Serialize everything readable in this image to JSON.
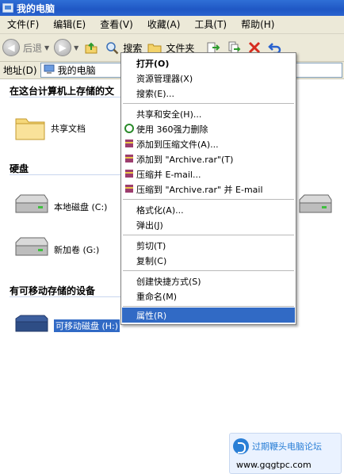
{
  "window": {
    "title": "我的电脑"
  },
  "menubar": [
    "文件(F)",
    "编辑(E)",
    "查看(V)",
    "收藏(A)",
    "工具(T)",
    "帮助(H)"
  ],
  "toolbar": {
    "back": "后退",
    "search": "搜索",
    "folders": "文件夹"
  },
  "address": {
    "label": "地址(D)",
    "value": "我的电脑"
  },
  "sections": {
    "stored": "在这台计算机上存储的文",
    "harddisks": "硬盘",
    "removable": "有可移动存储的设备"
  },
  "items": {
    "shared": "共享文档",
    "local_c": "本地磁盘 (C:)",
    "new_g": "新加卷 (G:)",
    "removable_h": "可移动磁盘 (H:)"
  },
  "context_menu": [
    {
      "label": "打开(O)",
      "bold": true
    },
    {
      "label": "资源管理器(X)"
    },
    {
      "label": "搜索(E)..."
    },
    {
      "label": "共享和安全(H)..."
    },
    {
      "label": "使用 360强力删除",
      "icon": "360-icon"
    },
    {
      "label": "添加到压缩文件(A)...",
      "icon": "winrar-icon"
    },
    {
      "label": "添加到 \"Archive.rar\"(T)",
      "icon": "winrar-icon"
    },
    {
      "label": "压缩并 E-mail...",
      "icon": "winrar-icon"
    },
    {
      "label": "压缩到 \"Archive.rar\" 并 E-mail",
      "icon": "winrar-icon"
    },
    {
      "label": "格式化(A)..."
    },
    {
      "label": "弹出(J)"
    },
    {
      "label": "剪切(T)"
    },
    {
      "label": "复制(C)"
    },
    {
      "label": "创建快捷方式(S)"
    },
    {
      "label": "重命名(M)"
    },
    {
      "label": "属性(R)",
      "highlighted": true
    }
  ],
  "watermark": {
    "title": "过期鞭头电脑论坛",
    "url": "www.gqgtpc.com"
  },
  "colors": {
    "title_blue": "#2a63cf",
    "selection": "#316ac5",
    "menu_bg": "#ece9d8"
  }
}
